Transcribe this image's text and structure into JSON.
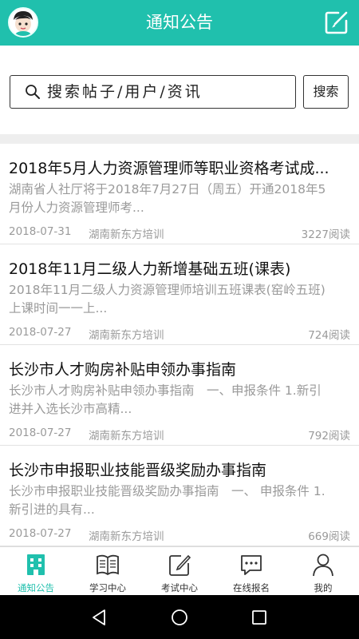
{
  "header": {
    "title": "通知公告"
  },
  "search": {
    "placeholder": "搜索帖子/用户/资讯",
    "button_label": "搜索"
  },
  "news": [
    {
      "title": "2018年5月人力资源管理师等职业资格考试成...",
      "summary": "湖南省人社厅将于2018年7月27日（周五）开通2018年5月份人力资源管理师考...",
      "date": "2018-07-31",
      "source": "湖南新东方培训",
      "views": "3227阅读"
    },
    {
      "title": "2018年11月二级人力新增基础五班(课表)",
      "summary": "2018年11月二级人力资源管理师培训五班课表(窑岭五班)　上课时间一一上...",
      "date": "2018-07-27",
      "source": "湖南新东方培训",
      "views": "724阅读"
    },
    {
      "title": "长沙市人才购房补贴申领办事指南",
      "summary": "长沙市人才购房补贴申领办事指南　一、申报条件 1.新引进并入选长沙市高精...",
      "date": "2018-07-27",
      "source": "湖南新东方培训",
      "views": "792阅读"
    },
    {
      "title": "长沙市申报职业技能晋级奖励办事指南",
      "summary": "长沙市申报职业技能晋级奖励办事指南　一、 申报条件 1.新引进的具有...",
      "date": "2018-07-27",
      "source": "湖南新东方培训",
      "views": "669阅读"
    }
  ],
  "tabs": [
    {
      "label": "通知公告",
      "icon": "building-icon",
      "active": true
    },
    {
      "label": "学习中心",
      "icon": "book-icon",
      "active": false
    },
    {
      "label": "考试中心",
      "icon": "edit-icon",
      "active": false
    },
    {
      "label": "在线报名",
      "icon": "chat-icon",
      "active": false
    },
    {
      "label": "我的",
      "icon": "user-icon",
      "active": false
    }
  ],
  "colors": {
    "brand": "#20c0ad",
    "muted_text": "#9a9a9a"
  }
}
